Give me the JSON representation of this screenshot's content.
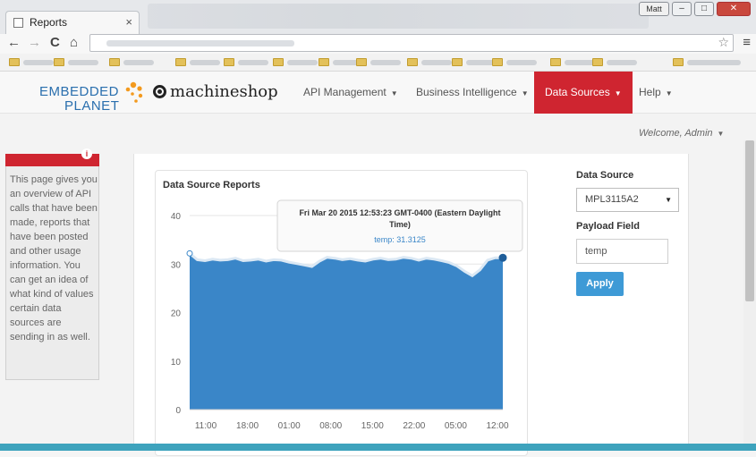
{
  "browser": {
    "tab_title": "Reports",
    "tab_close": "×",
    "window_user": "Matt",
    "nav_back": "←",
    "nav_forward": "→",
    "nav_reload": "C",
    "nav_home": "⌂",
    "star": "☆",
    "menu": "≡"
  },
  "site": {
    "logo_line1": "EMBEDDED",
    "logo_line2": "PLANET",
    "logo_ms": "machineshop",
    "nav": [
      {
        "label": "API Management"
      },
      {
        "label": "Business Intelligence"
      },
      {
        "label": "Data Sources"
      },
      {
        "label": "Help"
      }
    ],
    "welcome": "Welcome, Admin"
  },
  "help": {
    "text": "This page gives you an overview of API calls that have been made, reports that have been posted and other usage information. You can get an idea of what kind of values certain data sources are sending in as well."
  },
  "form": {
    "data_source_label": "Data Source",
    "data_source_value": "MPL3115A2",
    "payload_label": "Payload Field",
    "payload_value": "temp",
    "apply_label": "Apply"
  },
  "colors": {
    "accent_red": "#cf2530",
    "area_blue": "#3a86c8",
    "button_blue": "#3e9ad6"
  },
  "chart_data": {
    "type": "area",
    "title": "Data Source Reports",
    "xlabel": "",
    "ylabel": "",
    "ylim": [
      0,
      40
    ],
    "yticks": [
      0,
      10,
      20,
      30,
      40
    ],
    "xticks": [
      "11:00",
      "18:00",
      "01:00",
      "08:00",
      "15:00",
      "22:00",
      "05:00",
      "12:00"
    ],
    "grid": true,
    "series": [
      {
        "values": [
          32.2,
          30.9,
          30.7,
          31.0,
          30.8,
          30.9,
          31.2,
          30.7,
          30.8,
          31.0,
          30.6,
          30.9,
          30.8,
          30.4,
          30.1,
          29.8,
          29.5,
          30.6,
          31.4,
          31.2,
          30.9,
          31.1,
          30.8,
          30.6,
          31.0,
          31.2,
          30.9,
          31.0,
          31.4,
          31.2,
          30.8,
          31.2,
          31.0,
          30.7,
          30.3,
          29.6,
          28.5,
          27.6,
          28.8,
          30.8,
          31.3,
          31.3
        ]
      }
    ],
    "tooltip": {
      "line1": "Fri Mar 20 2015 12:53:23 GMT-0400 (Eastern Daylight",
      "line2": "Time)",
      "value_text": "temp: 31.3125"
    }
  }
}
